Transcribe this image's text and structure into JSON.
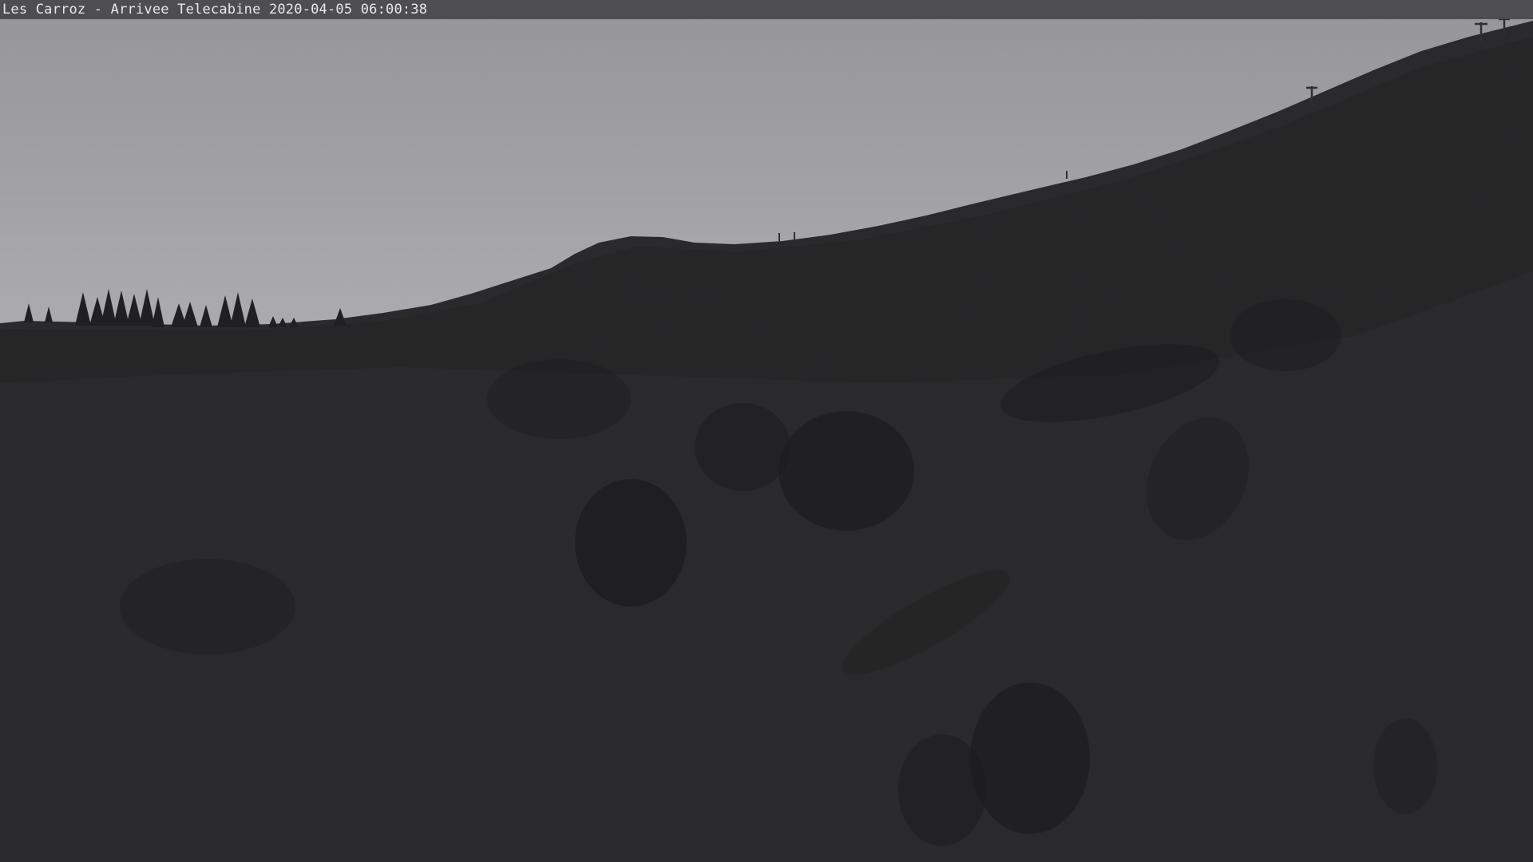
{
  "webcam": {
    "location": "Les Carroz",
    "separator": " - ",
    "camera": "Arrivee Telecabine",
    "date": "2020-04-05",
    "time": "06:00:38"
  },
  "scene": {
    "sky_top_color": "#97979c",
    "sky_horizon_color": "#d4d4d8",
    "ground_color": "#252527",
    "ridge_color": "#1d1d1f",
    "shadow_color": "#161618"
  }
}
